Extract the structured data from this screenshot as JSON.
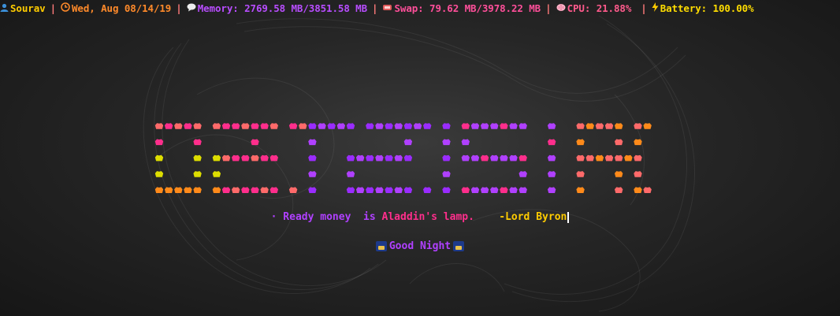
{
  "statusbar": {
    "user": "Sourav",
    "date": "Wed, Aug 08/14/19",
    "memory": "Memory: 2769.58 MB/3851.58 MB",
    "swap": "Swap: 79.62 MB/3978.22 MB",
    "cpu": "CPU:  21.88%",
    "battery": "Battery: 100.00%",
    "separator": "|",
    "icons": [
      "user-icon",
      "clock-icon",
      "speech-bubble-icon",
      "chip-icon",
      "brain-icon",
      "lightning-icon"
    ],
    "colors": {
      "user": "#ffcc00",
      "date": "#ff8a2a",
      "memory": "#b84dff",
      "swap": "#ff4f9a",
      "cpu": "#ff5a8c",
      "battery": "#ffdd00"
    }
  },
  "banner": {
    "description": "pixel-art text made of small colored pentagon glyphs",
    "palette": [
      "#ff6a6a",
      "#ff2e8c",
      "#ff8a1a",
      "#dddd00",
      "#b040ff",
      "#9a2cff"
    ]
  },
  "quote": {
    "bullet": "·",
    "part1": "Ready money  is ",
    "part2": "Aladdin's lamp.",
    "author": "-Lord Byron"
  },
  "greeting": {
    "text": "Good Night",
    "icon": "night-city-icon"
  }
}
